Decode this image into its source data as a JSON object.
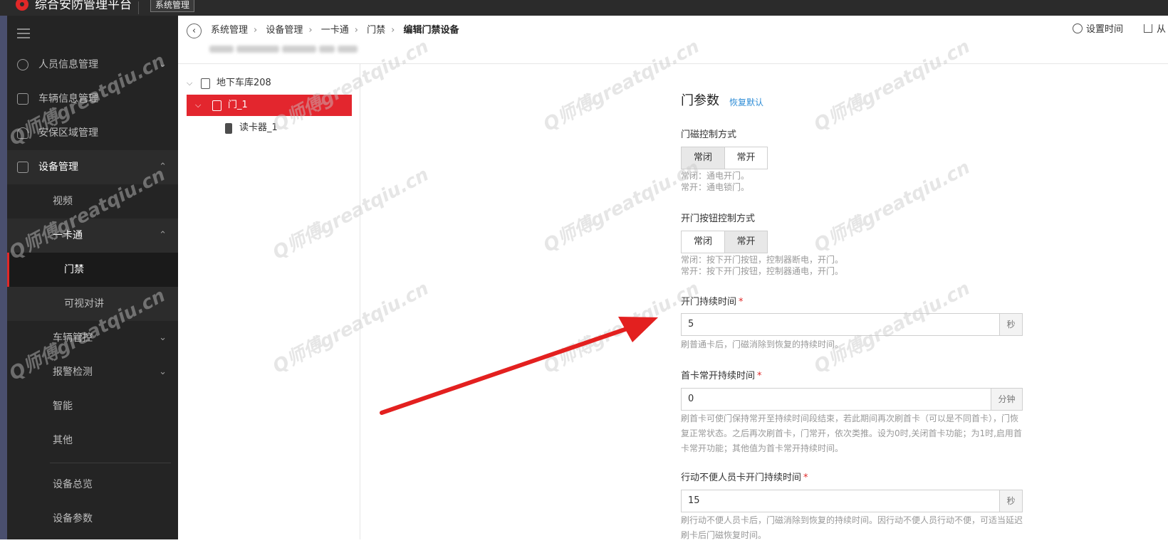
{
  "app": {
    "title": "综合安防管理平台",
    "tab": "系统管理"
  },
  "sidebar": {
    "items": [
      {
        "label": "人员信息管理",
        "icon": "person-icon",
        "chevron": "⌄"
      },
      {
        "label": "车辆信息管理",
        "icon": "car-icon"
      },
      {
        "label": "安保区域管理",
        "icon": "shield-icon"
      },
      {
        "label": "设备管理",
        "icon": "device-icon",
        "chevron": "⌃"
      },
      {
        "label": "视频"
      },
      {
        "label": "一卡通",
        "chevron": "⌃"
      },
      {
        "label": "门禁"
      },
      {
        "label": "可视对讲"
      },
      {
        "label": "车辆管控",
        "chevron": "⌄"
      },
      {
        "label": "报警检测",
        "chevron": "⌄"
      },
      {
        "label": "智能"
      },
      {
        "label": "其他"
      },
      {
        "label": "设备总览"
      },
      {
        "label": "设备参数"
      }
    ]
  },
  "header": {
    "breadcrumb": [
      "系统管理",
      "设备管理",
      "一卡通",
      "门禁",
      "编辑门禁设备"
    ],
    "actions": {
      "set_time": "设置时间",
      "export": "从"
    }
  },
  "tree": {
    "root": "地下车库208",
    "door": "门_1",
    "reader": "读卡器_1"
  },
  "form": {
    "title": "门参数",
    "reset": "恢复默认",
    "magnetic": {
      "label": "门磁控制方式",
      "options": [
        "常闭",
        "常开"
      ],
      "selected": "常闭",
      "help1": "常闭：通电开门。",
      "help2": "常开：通电锁门。"
    },
    "button": {
      "label": "开门按钮控制方式",
      "options": [
        "常闭",
        "常开"
      ],
      "selected": "常开",
      "help1": "常闭：按下开门按钮，控制器断电，开门。",
      "help2": "常开：按下开门按钮，控制器通电，开门。"
    },
    "duration": {
      "label": "开门持续时间",
      "value": "5",
      "unit": "秒",
      "help": "刷普通卡后，门磁消除到恢复的持续时间。"
    },
    "first_card": {
      "label": "首卡常开持续时间",
      "value": "0",
      "unit": "分钟",
      "help": "刷首卡可使门保持常开至持续时间段结束，若此期间再次刷首卡（可以是不同首卡），门恢复正常状态。之后再次刷首卡，门常开，依次类推。设为0时,关闭首卡功能；为1时,启用首卡常开功能；其他值为首卡常开持续时间。"
    },
    "disabled": {
      "label": "行动不便人员卡开门持续时间",
      "value": "15",
      "unit": "秒",
      "help": "刷行动不便人员卡后，门磁消除到恢复的持续时间。因行动不便人员行动不便，可适当延迟刷卡后门磁恢复时间。"
    },
    "required_mark": "*"
  },
  "watermark": "Q师傅greatqiu.cn",
  "colors": {
    "accent": "#e3262e",
    "link": "#2d8cd6",
    "sidebar": "#242424"
  }
}
